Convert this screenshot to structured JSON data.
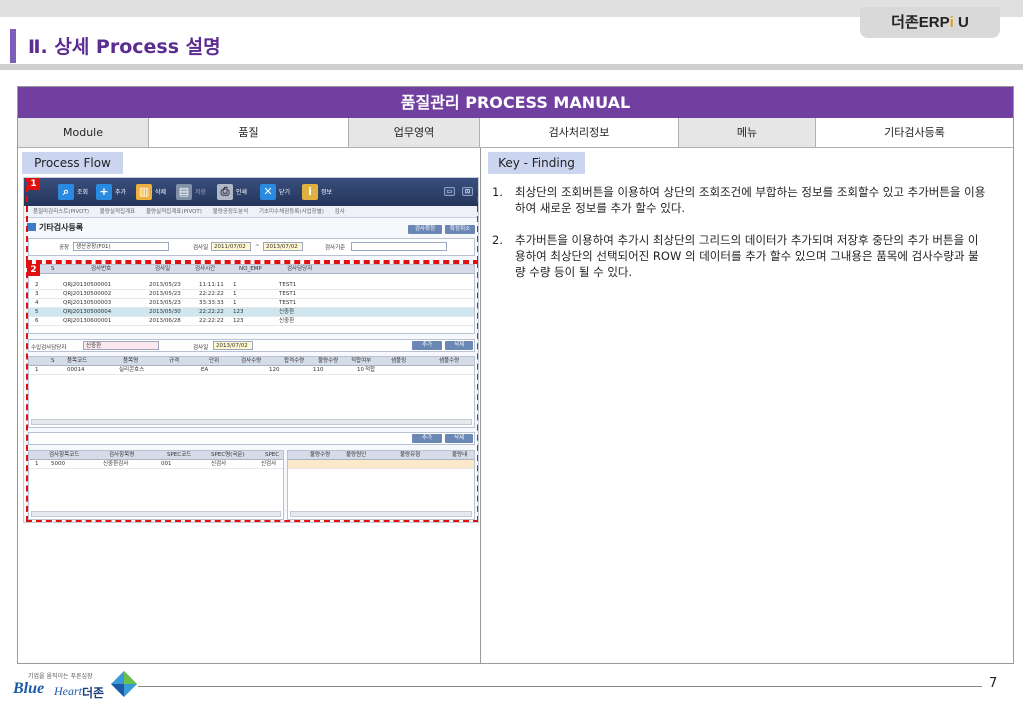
{
  "brand": {
    "prefix": "더존ERP",
    "slash": "i",
    "suffix": "U"
  },
  "page_title": "Ⅱ. 상세 Process 설명",
  "manual_title": "품질관리 PROCESS MANUAL",
  "info_row": [
    {
      "label": "Module"
    },
    {
      "label": "품질"
    },
    {
      "label": "업무영역"
    },
    {
      "label": "검사처리정보"
    },
    {
      "label": "메뉴"
    },
    {
      "label": "기타검사등록"
    }
  ],
  "process_flow_label": "Process Flow",
  "key_finding_label": "Key - Finding",
  "findings": [
    {
      "num": "1.",
      "text": "최상단의 조회버튼을 이용하여 상단의 조회조건에 부합하는 정보를 조회할수 있고 추가버튼을 이용하여 새로운 정보를 추가 할수 있다."
    },
    {
      "num": "2.",
      "text": "추가버튼을 이용하여 추가시 최상단의 그리드의 데이터가 추가되며 저장후 중단의 추가 버튼을 이용하여 최상단의 선택되어진 ROW 의 데이터를 추가 할수 있으며 그내용은 품목에 검사수량과 불량 수량 등이 될 수 있다."
    }
  ],
  "screen": {
    "toolbar": [
      {
        "label": "조회",
        "icon": "search-icon",
        "color": "#2a8ae0",
        "glyph": "🔍"
      },
      {
        "label": "추가",
        "icon": "plus-icon",
        "color": "#2a8ae0",
        "glyph": "✚"
      },
      {
        "label": "삭제",
        "icon": "trash-icon",
        "color": "#e8a030",
        "glyph": "🗑"
      },
      {
        "label": "저장",
        "icon": "save-icon",
        "color": "#8090a8",
        "glyph": "▤"
      },
      {
        "label": "인쇄",
        "icon": "print-icon",
        "color": "#a0a8b8",
        "glyph": "⎙"
      },
      {
        "label": "닫기",
        "icon": "close-icon",
        "color": "#2a8ae0",
        "glyph": "✖"
      },
      {
        "label": "정보",
        "icon": "info-icon",
        "color": "#e0b040",
        "glyph": "ⓘ"
      }
    ],
    "menu_tabs": [
      "품질마감리스트(PIVOT)",
      "불량실적집계표",
      "불량실적집계표(PIVOT)",
      "불량공정도분석",
      "기초미수채권등록(사업장별)",
      "검사"
    ],
    "form_title": "기타검사등록",
    "btn_inspect_confirm": "검사확정",
    "btn_confirm_cancel": "확정취소",
    "filter": {
      "plant_label": "공장",
      "plant_value": "생산공장(F01)",
      "date_label": "검사일",
      "date_from": "2011/07/02",
      "date_tilde": "~",
      "date_to": "2013/07/02",
      "basis_label": "검사기준",
      "basis_value": ""
    },
    "grid1": {
      "headers": [
        "S",
        "검사번호",
        "검사일",
        "검사시간",
        "NO_EMP",
        "검사담당자"
      ],
      "rows": [
        [
          "2",
          "QRJ20130500001",
          "2013/05/23",
          "11:11:11",
          "1",
          "TEST1"
        ],
        [
          "3",
          "QRJ20130500002",
          "2013/05/23",
          "22:22:22",
          "1",
          "TEST1"
        ],
        [
          "4",
          "QRJ20130500003",
          "2013/05/23",
          "33:33:33",
          "1",
          "TEST1"
        ],
        [
          "5",
          "QRJ20130500004",
          "2013/05/30",
          "22:22:22",
          "123",
          "신중환"
        ],
        [
          "6",
          "QRJ20130600001",
          "2013/06/28",
          "22:22:22",
          "123",
          "신중환"
        ]
      ]
    },
    "sub_filter": {
      "inspector_label": "수입검사담당자",
      "inspector_value": "신중환",
      "date_label": "검사일",
      "date_value": "2013/07/02",
      "btn_add": "추가",
      "btn_delete": "삭제"
    },
    "grid2": {
      "headers": [
        "S",
        "품목코드",
        "품목명",
        "규격",
        "단위",
        "검사수량",
        "합격수량",
        "불량수량",
        "적합여부",
        "샘플링",
        "샘플수량"
      ],
      "rows": [
        [
          "1",
          "00014",
          "실리콘호스",
          "",
          "EA",
          "120",
          "110",
          "10",
          "적합",
          "",
          ""
        ]
      ]
    },
    "btn_add2": "추가",
    "btn_delete2": "삭제",
    "grid3": {
      "headers": [
        "검사항목코드",
        "검사항목명",
        "SPEC코드",
        "SPEC명(국문)",
        "SPEC"
      ],
      "rows": [
        [
          "1",
          "5000",
          "신중환검사",
          "001",
          "신검사",
          "신검사"
        ]
      ]
    },
    "grid4": {
      "headers": [
        "불량수량",
        "불량원인",
        "불량유형",
        "불량내"
      ]
    },
    "badge1": "1",
    "badge2": "2"
  },
  "footer": {
    "small": "기업을 움직이는 푸른심장",
    "bh": "Blue",
    "bh2": "Heart",
    "kr": "더존",
    "page": "7"
  }
}
